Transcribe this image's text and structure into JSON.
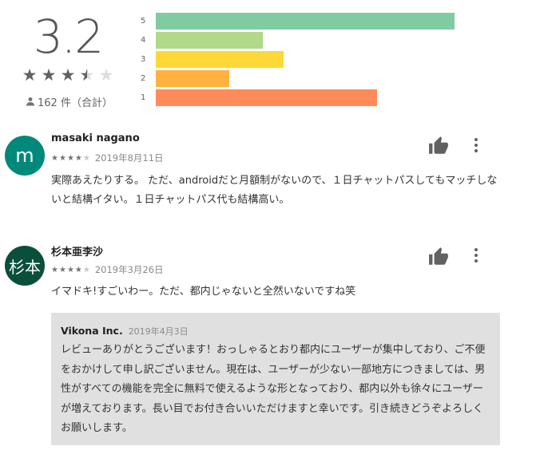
{
  "summary": {
    "score": "3.2",
    "stars": [
      1,
      1,
      1,
      0.5,
      0
    ],
    "total_count": "162 件（合計）",
    "distribution": [
      {
        "label": "5",
        "fraction": 0.89,
        "color": "#7fcca0"
      },
      {
        "label": "4",
        "fraction": 0.32,
        "color": "#b2d88a"
      },
      {
        "label": "3",
        "fraction": 0.38,
        "color": "#fdd836"
      },
      {
        "label": "2",
        "fraction": 0.22,
        "color": "#ffb240"
      },
      {
        "label": "1",
        "fraction": 0.66,
        "color": "#ff8b5b"
      }
    ]
  },
  "reviews": [
    {
      "avatar_text": "m",
      "avatar_color": "#00897b",
      "author": "masaki nagano",
      "rating": 4,
      "date": "2019年8月11日",
      "text": "実際あえたりする。 ただ、androidだと月額制がないので、１日チャットパスしてもマッチしないと結構イタい。１日チャットパス代も結構高い。"
    },
    {
      "avatar_text": "杉本",
      "avatar_color": "#0a4f3c",
      "author": "杉本亜李沙",
      "rating": 4,
      "date": "2019年3月26日",
      "text": "イマドキ!すごいわー。ただ、都内じゃないと全然いないですね笑",
      "reply": {
        "developer": "Vikona Inc.",
        "date": "2019年4月3日",
        "text": "レビューありがとうございます！おっしゃるとおり都内にユーザーが集中しており、ご不便をおかけして申し訳ございません。現在は、ユーザーが少ない一部地方につきましては、男性がすべての機能を完全に無料で使えるような形となっており、都内以外も徐々にユーザーが増えております。長い目でお付き合いいただけますと幸いです。引き続きどうぞよろしくお願いします。"
      }
    }
  ],
  "icons": {
    "person": "person-icon",
    "thumb": "thumb-up-icon",
    "more": "more-vert-icon",
    "star": "star-icon"
  }
}
